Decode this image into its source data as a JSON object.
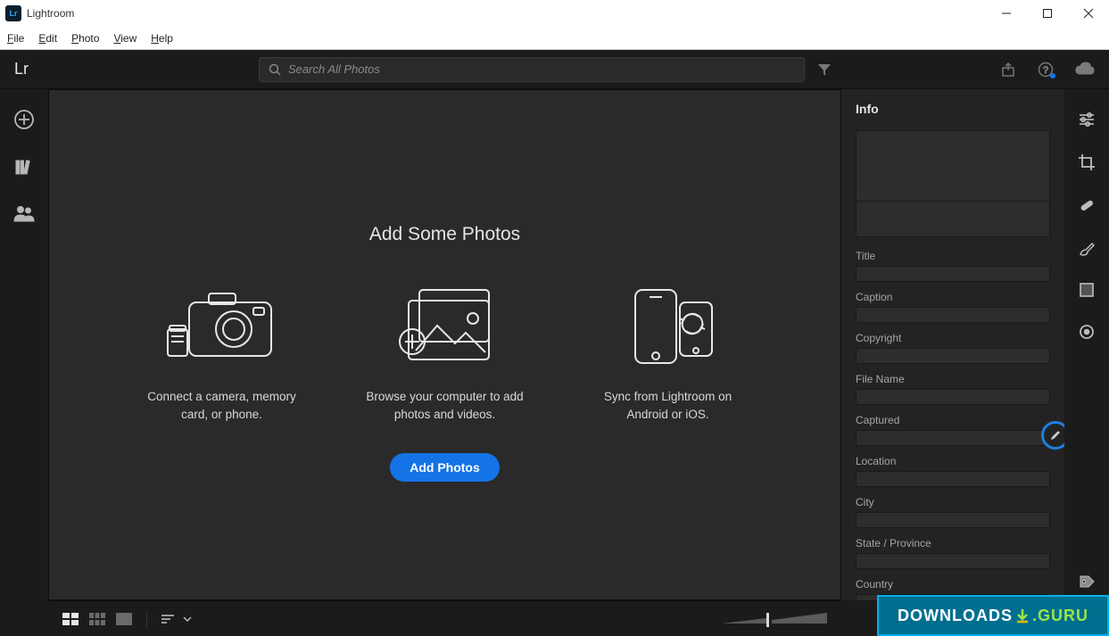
{
  "title_bar": {
    "app_name": "Lightroom"
  },
  "menu": {
    "items": [
      "File",
      "Edit",
      "Photo",
      "View",
      "Help"
    ]
  },
  "app_header": {
    "logo_text": "Lr",
    "search_placeholder": "Search All Photos"
  },
  "main": {
    "heading": "Add Some Photos",
    "cards": [
      {
        "text": "Connect a camera, memory card, or phone."
      },
      {
        "text": "Browse your computer to add photos and videos."
      },
      {
        "text": "Sync from Lightroom on Android or iOS."
      }
    ],
    "add_button": "Add Photos"
  },
  "info_panel": {
    "header": "Info",
    "fields": [
      "Title",
      "Caption",
      "Copyright",
      "File Name",
      "Captured",
      "Location",
      "City",
      "State / Province",
      "Country"
    ]
  },
  "right_tools": [
    "sliders",
    "crop",
    "healing",
    "brush",
    "gradient",
    "radial"
  ],
  "watermark": {
    "left": "DOWNLOADS",
    "right": ".GURU"
  }
}
